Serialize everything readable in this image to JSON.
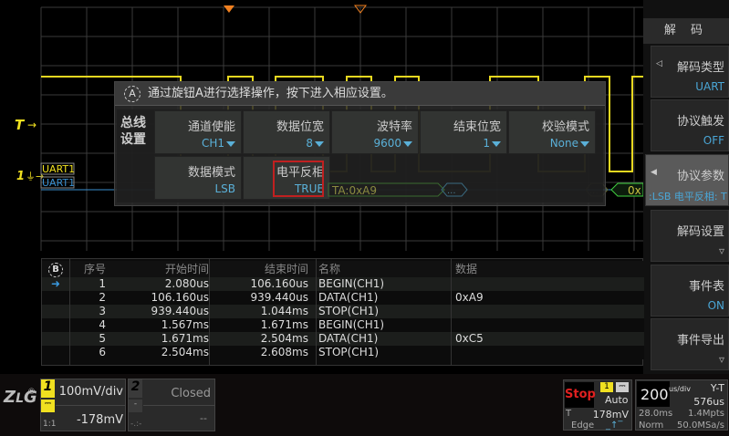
{
  "scope": {
    "trigger_marker": "T",
    "channel_marker": "1",
    "bus_labels": [
      "UART1",
      "UART1"
    ],
    "bus_segments": [
      "TA:0xA9",
      "...",
      "...",
      "0x"
    ],
    "colors": {
      "ch1": "#f0e020",
      "bus": "#3a90d0",
      "trigger": "#f08020",
      "selection": "#c02020",
      "value": "#5ab0d8"
    }
  },
  "overlay": {
    "icon": "A",
    "hint": "通过旋钮A进行选择操作，按下进入相应设置。",
    "group_label": "总线设置",
    "cells": [
      {
        "label": "通道使能",
        "value": "CH1"
      },
      {
        "label": "数据位宽",
        "value": "8"
      },
      {
        "label": "波特率",
        "value": "9600"
      },
      {
        "label": "结束位宽",
        "value": "1"
      },
      {
        "label": "校验模式",
        "value": "None"
      },
      {
        "label": "数据模式",
        "value": "LSB"
      },
      {
        "label": "电平反相",
        "value": "TRUE"
      }
    ]
  },
  "sidebar": {
    "title": "解 码",
    "buttons": [
      {
        "label": "解码类型",
        "value": "UART"
      },
      {
        "label": "协议触发",
        "value": "OFF"
      },
      {
        "label": "协议参数",
        "value": ":LSB  电平反相: T"
      },
      {
        "label": "解码设置",
        "value": "▿"
      },
      {
        "label": "事件表",
        "value": "ON"
      },
      {
        "label": "事件导出",
        "value": "▿"
      }
    ]
  },
  "table": {
    "icon": "B",
    "headers": [
      "序号",
      "开始时间",
      "结束时间",
      "名称",
      "数据"
    ],
    "rows": [
      {
        "n": "1",
        "start": "2.080us",
        "end": "106.160us",
        "name": "BEGIN(CH1)",
        "data": ""
      },
      {
        "n": "2",
        "start": "106.160us",
        "end": "939.440us",
        "name": "DATA(CH1)",
        "data": "0xA9"
      },
      {
        "n": "3",
        "start": "939.440us",
        "end": "1.044ms",
        "name": "STOP(CH1)",
        "data": ""
      },
      {
        "n": "4",
        "start": "1.567ms",
        "end": "1.671ms",
        "name": "BEGIN(CH1)",
        "data": ""
      },
      {
        "n": "5",
        "start": "1.671ms",
        "end": "2.504ms",
        "name": "DATA(CH1)",
        "data": "0xC5"
      },
      {
        "n": "6",
        "start": "2.504ms",
        "end": "2.608ms",
        "name": "STOP(CH1)",
        "data": ""
      }
    ]
  },
  "status": {
    "logo": "ZLG",
    "ch1": {
      "num": "1",
      "scale": "100mV/div",
      "offset": "-178mV",
      "probe": "1:1"
    },
    "ch2": {
      "num": "2",
      "state": "Closed",
      "offset": "--",
      "probe": "-.:-"
    },
    "run_state": "Stop",
    "trig_source": "1",
    "trig_mode": "Auto",
    "trig_label": "T",
    "trig_level": "178mV",
    "trig_type": "Edge",
    "timebase": "200",
    "timebase_unit": "us/div",
    "mode": "Y-T",
    "delay": "576us",
    "record_time": "28.0ms",
    "memory": "1.4Mpts",
    "acq": "Norm",
    "sample_rate": "50.0MSa/s"
  }
}
